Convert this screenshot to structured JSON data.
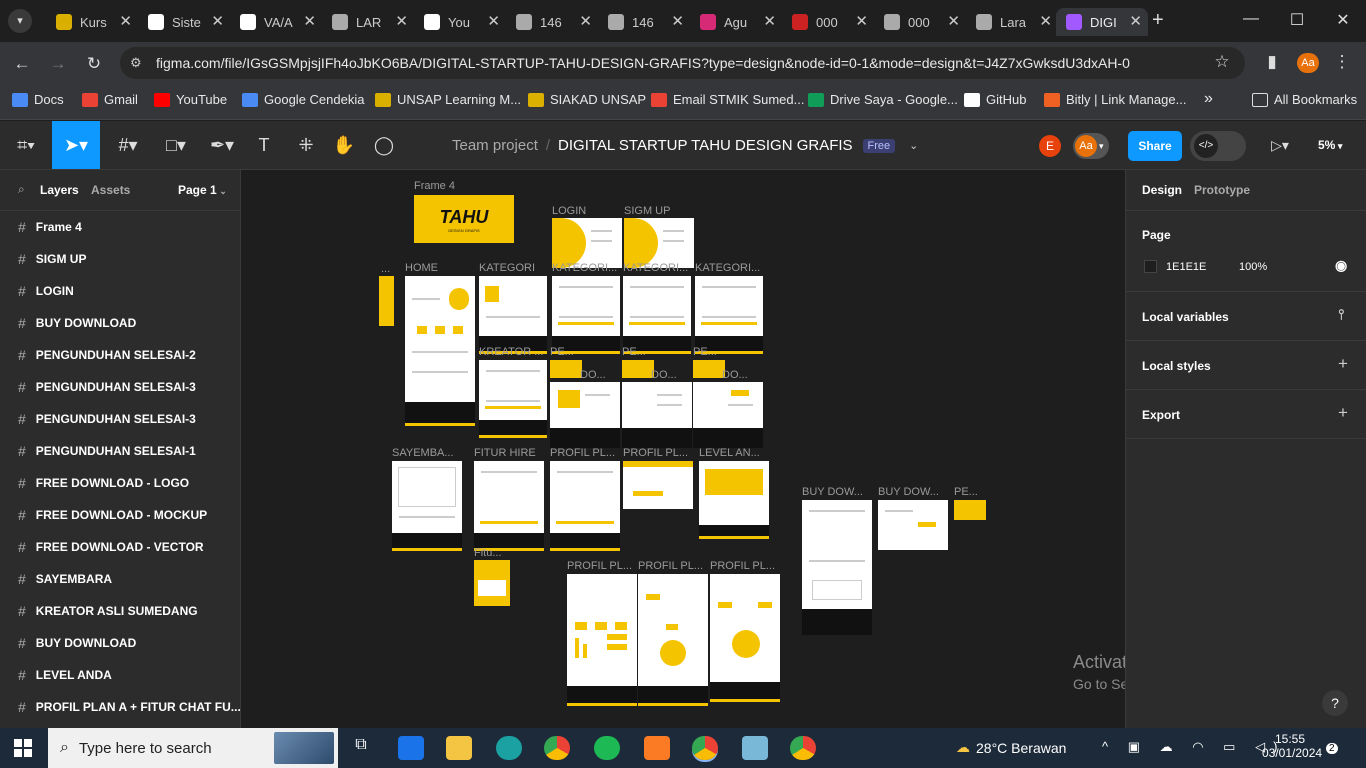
{
  "browser": {
    "tabs": [
      {
        "label": "Kurs",
        "color": "#d9b000"
      },
      {
        "label": "Siste",
        "color": "#ffffff"
      },
      {
        "label": "VA/A",
        "color": "#ffffff"
      },
      {
        "label": "LAR",
        "color": "#aaaaaa"
      },
      {
        "label": "You",
        "color": "#ffffff"
      },
      {
        "label": "146",
        "color": "#aaaaaa"
      },
      {
        "label": "146",
        "color": "#aaaaaa"
      },
      {
        "label": "Agu",
        "color": "#d62976"
      },
      {
        "label": "000",
        "color": "#cc2222"
      },
      {
        "label": "000",
        "color": "#aaaaaa"
      },
      {
        "label": "Lara",
        "color": "#aaaaaa"
      },
      {
        "label": "DIGI",
        "color": "#a259ff"
      }
    ],
    "new_tab": "+",
    "window_controls": {
      "minimize": "—",
      "maximize": "☐",
      "close": "✕"
    },
    "url": "figma.com/file/IGsGSMpjsjIFh4oJbKO6BA/DIGITAL-STARTUP-TAHU-DESIGN-GRAFIS?type=design&node-id=0-1&mode=design&t=J4Z7xGwksdU3dxAH-0",
    "profile_initials": "Aa",
    "bookmarks": [
      {
        "label": "Docs",
        "color": "#4a8af4"
      },
      {
        "label": "Gmail",
        "color": "#ea4335"
      },
      {
        "label": "YouTube",
        "color": "#ff0000"
      },
      {
        "label": "Google Cendekia",
        "color": "#4a8af4"
      },
      {
        "label": "UNSAP Learning M...",
        "color": "#d9b000"
      },
      {
        "label": "SIAKAD UNSAP",
        "color": "#d9b000"
      },
      {
        "label": "Email STMIK Sumed...",
        "color": "#ea4335"
      },
      {
        "label": "Drive Saya - Google...",
        "color": "#0f9d58"
      },
      {
        "label": "GitHub",
        "color": "#ffffff"
      },
      {
        "label": "Bitly | Link Manage...",
        "color": "#ee6123"
      }
    ],
    "bookmarks_more": "»",
    "all_bookmarks": "All Bookmarks"
  },
  "figma": {
    "team": "Team project",
    "file_name": "DIGITAL STARTUP TAHU DESIGN GRAFIS",
    "plan_badge": "Free",
    "user_avatar": "E",
    "user_avatar2": "Aa",
    "share_label": "Share",
    "zoom": "5%",
    "left_tabs": {
      "layers": "Layers",
      "assets": "Assets",
      "page": "Page 1"
    },
    "layers": [
      "Frame 4",
      "SIGM UP",
      "LOGIN",
      "BUY DOWNLOAD",
      "PENGUNDUHAN SELESAI-2",
      "PENGUNDUHAN SELESAI-3",
      "PENGUNDUHAN SELESAI-3",
      "PENGUNDUHAN SELESAI-1",
      "FREE DOWNLOAD - LOGO",
      "FREE DOWNLOAD - MOCKUP",
      "FREE DOWNLOAD - VECTOR",
      "SAYEMBARA",
      "KREATOR ASLI SUMEDANG",
      "BUY DOWNLOAD",
      "LEVEL ANDA",
      "PROFIL PLAN A + FITUR CHAT FU..."
    ],
    "right_tabs": {
      "design": "Design",
      "prototype": "Prototype"
    },
    "page_section": {
      "title": "Page",
      "color_hex": "1E1E1E",
      "opacity": "100%"
    },
    "local_variables": "Local variables",
    "local_styles": "Local styles",
    "export": "Export",
    "help": "?",
    "canvas_labels": {
      "frame4": "Frame 4",
      "logo_text": "TAHU",
      "logo_sub": "DESIGN GRAFIS",
      "login": "LOGIN",
      "signup": "SIGM UP",
      "home": "HOME",
      "kategori": "KATEGORI",
      "kategori2": "KATEGORI...",
      "kategori3": "KATEGORI...",
      "kategori4": "KATEGORI...",
      "kreator": "KREATOR ...",
      "pe1": "PE...",
      "pe2": "PE...",
      "pe3": "PE...",
      "do1": "DO...",
      "do2": "DO...",
      "do3": "DO...",
      "dots": "...",
      "sayembara": "SAYEMBA...",
      "fitur_hire": "FITUR HIRE",
      "profil1": "PROFIL PL...",
      "profil2": "PROFIL PL...",
      "level": "LEVEL AN...",
      "buy1": "BUY DOW...",
      "buy2": "BUY DOW...",
      "pe4": "PE...",
      "fitu": "Fitu...",
      "profil3": "PROFIL PL...",
      "profil4": "PROFIL PL...",
      "profil5": "PROFIL PL..."
    }
  },
  "watermark": {
    "title": "Activate Windows",
    "subtitle": "Go to Settings to activate Windows."
  },
  "taskbar": {
    "search_placeholder": "Type here to search",
    "weather": "28°C  Berawan",
    "time": "15:55",
    "date": "03/01/2024",
    "notifications": "2"
  }
}
